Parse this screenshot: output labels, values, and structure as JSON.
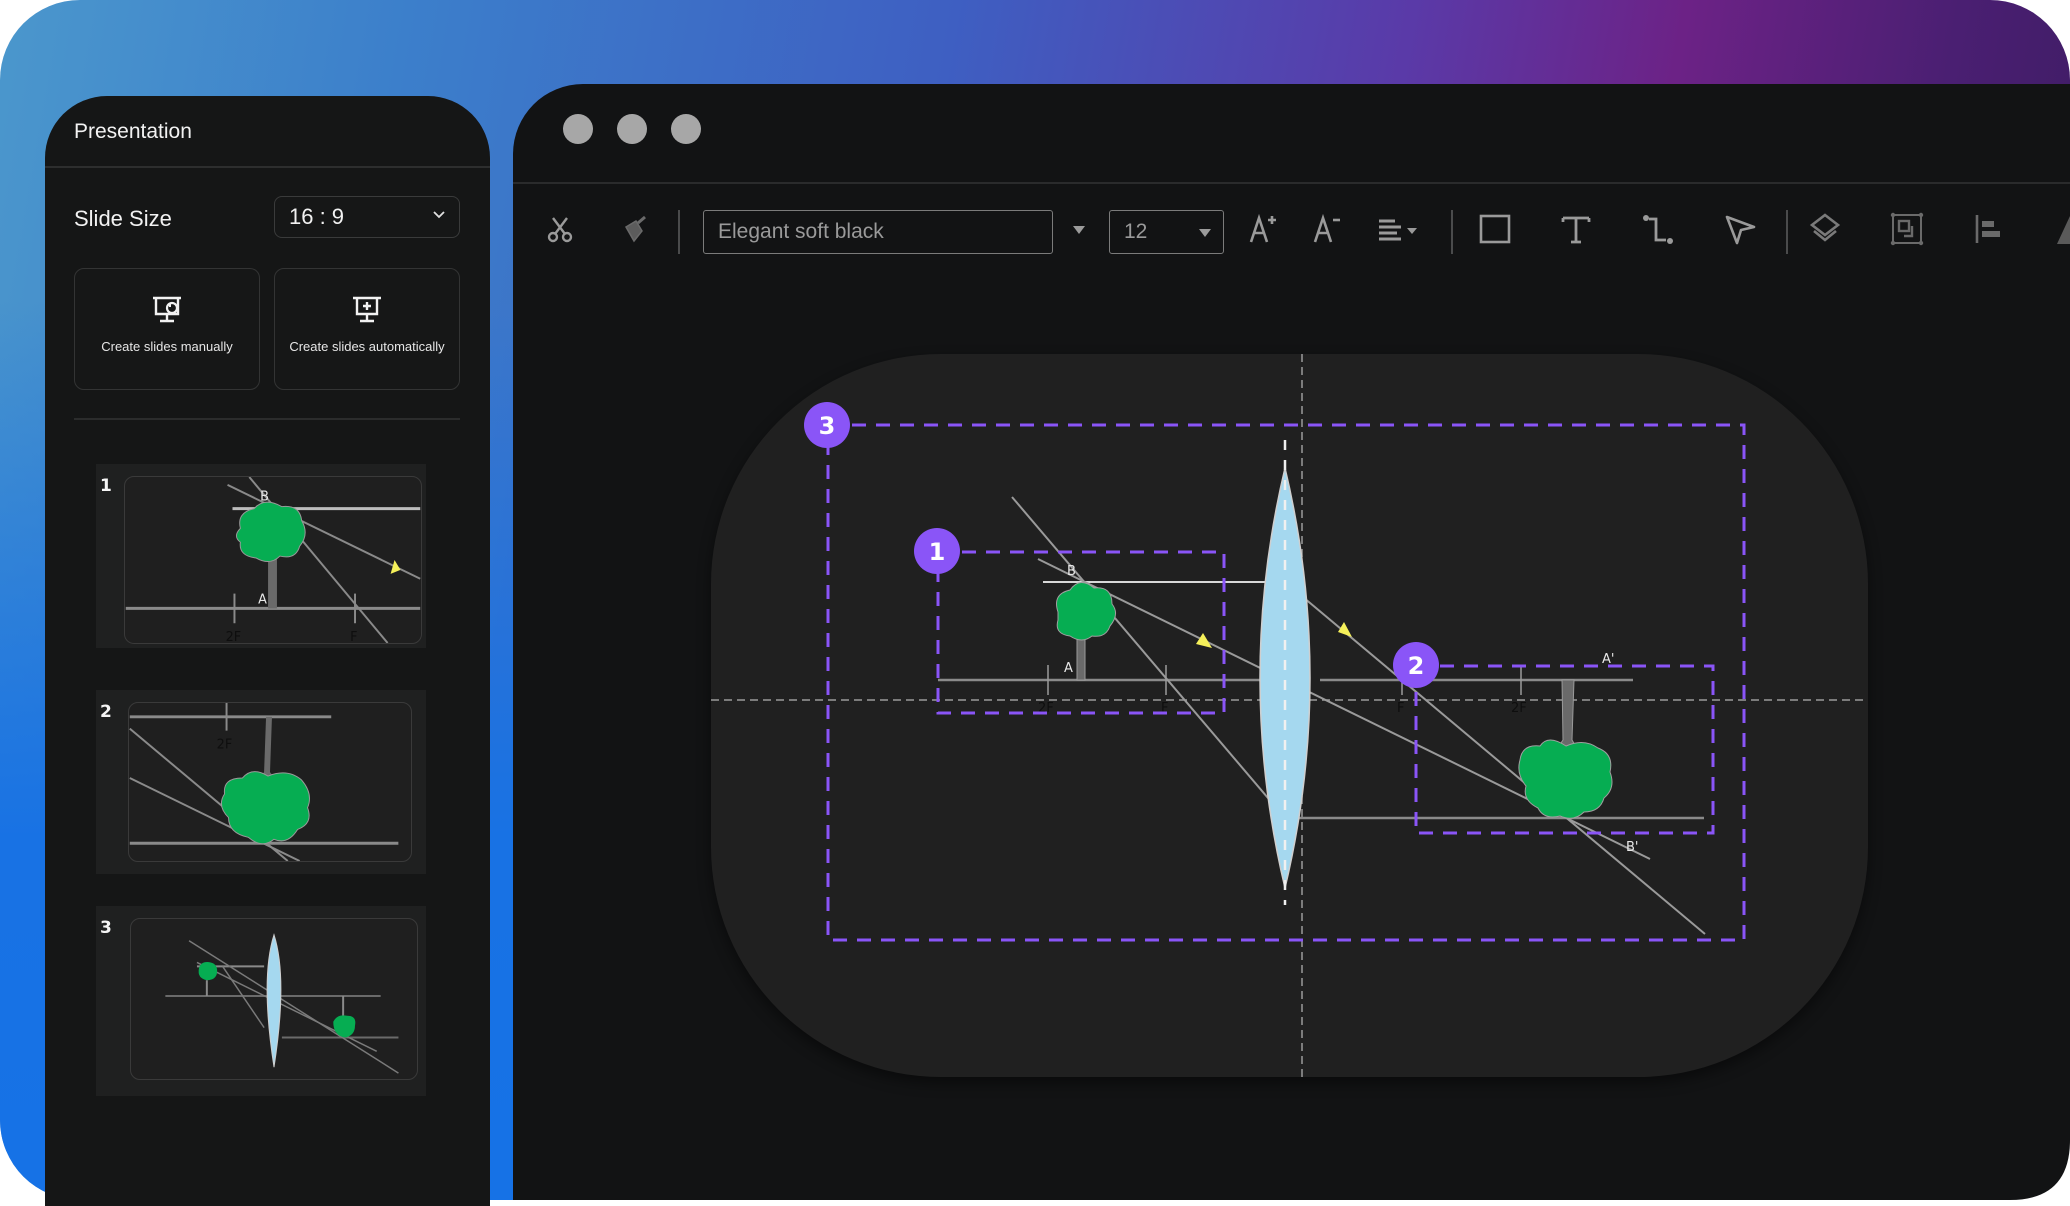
{
  "panel": {
    "title": "Presentation",
    "slide_size_label": "Slide Size",
    "slide_size_value": "16 : 9",
    "slide_size_icon": "chevron-down-icon",
    "create_manual_label": "Create slides manually",
    "create_manual_icon": "presentation-board-hand-icon",
    "create_auto_label": "Create slides automatically",
    "create_auto_icon": "presentation-board-plus-icon",
    "slides": [
      {
        "number": "1",
        "labels": [
          "B",
          "A",
          "2F",
          "F"
        ]
      },
      {
        "number": "2",
        "labels": [
          "2F"
        ]
      },
      {
        "number": "3",
        "labels": []
      }
    ]
  },
  "window": {
    "traffic_lights": [
      "close",
      "minimize",
      "maximize"
    ],
    "toolbar": {
      "cut_icon": "scissors-icon",
      "format_painter_icon": "paint-brush-icon",
      "font_name": "Elegant soft black",
      "font_size": "12",
      "increase_font_icon": "font-increase-icon",
      "decrease_font_icon": "font-decrease-icon",
      "align_icon": "align-left-dropdown-icon",
      "rectangle_icon": "rectangle-icon",
      "text_icon": "text-tool-icon",
      "connector_icon": "connector-icon",
      "pointer_icon": "pointer-arrow-icon",
      "layers_icon": "layers-icon",
      "group_icon": "group-icon",
      "align_objects_icon": "align-objects-icon",
      "more_icon": "triangle-shape-icon"
    }
  },
  "canvas": {
    "diagram_labels": {
      "object_top": "B",
      "object_base": "A",
      "left_2f": "2F",
      "left_f": "F",
      "right_f": "F",
      "right_2f": "2F",
      "image_top": "A'",
      "image_bottom": "B'"
    },
    "markers": [
      {
        "number": "1",
        "target": "object-group"
      },
      {
        "number": "2",
        "target": "image-group"
      },
      {
        "number": "3",
        "target": "whole-diagram"
      }
    ],
    "colors": {
      "marker": "#8a55f7",
      "lens": "#a5d8ef",
      "tree": "#06ad52",
      "arrow": "#f5f05a"
    }
  }
}
